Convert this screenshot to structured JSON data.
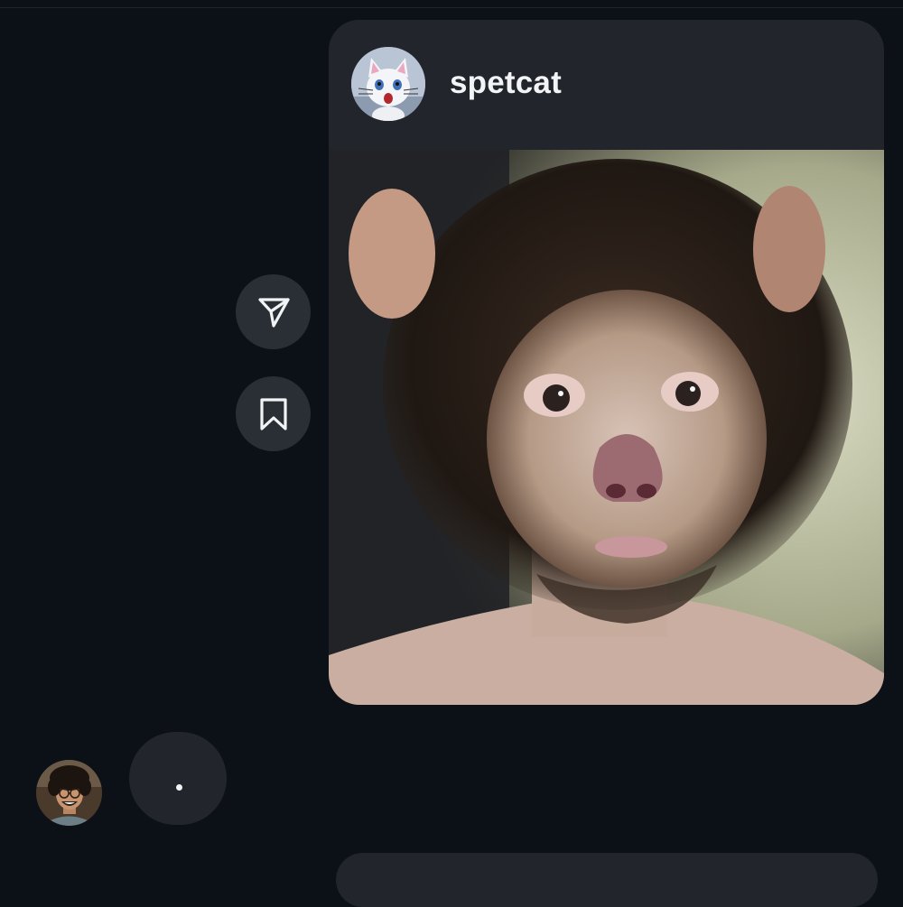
{
  "shared_post": {
    "username": "spetcat",
    "avatar_icon": "white-cat-figurine-avatar",
    "image_description_icon": "monkey-face-photo"
  },
  "actions": {
    "share_icon": "paper-plane-icon",
    "save_icon": "bookmark-icon"
  },
  "sender": {
    "avatar_icon": "curly-haired-man-avatar"
  },
  "typing_indicator": {
    "dots": 1
  },
  "colors": {
    "background": "#0c1117",
    "card": "#22262c",
    "button": "#2a2f36",
    "text": "#f1f3f5"
  }
}
